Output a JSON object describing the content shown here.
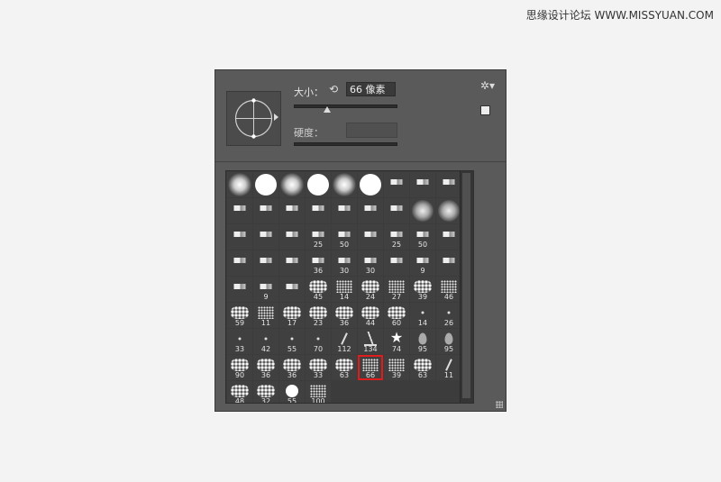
{
  "watermark": "思缘设计论坛 WWW.MISSYUAN.COM",
  "panel": {
    "size_label": "大小：",
    "size_value": "66 像素",
    "hardness_label": "硬度：",
    "reset_icon": "reset-icon",
    "gear_icon": "gear-icon",
    "new_preset_icon": "new-preset-icon"
  },
  "brushes": [
    {
      "shape": "soft",
      "num": ""
    },
    {
      "shape": "hard",
      "num": ""
    },
    {
      "shape": "soft",
      "num": ""
    },
    {
      "shape": "hard",
      "num": ""
    },
    {
      "shape": "soft",
      "num": ""
    },
    {
      "shape": "hard",
      "num": ""
    },
    {
      "shape": "tip",
      "num": ""
    },
    {
      "shape": "tip",
      "num": ""
    },
    {
      "shape": "tip",
      "num": ""
    },
    {
      "shape": "tip",
      "num": ""
    },
    {
      "shape": "tip",
      "num": ""
    },
    {
      "shape": "tip",
      "num": ""
    },
    {
      "shape": "tip",
      "num": ""
    },
    {
      "shape": "tip",
      "num": ""
    },
    {
      "shape": "tip",
      "num": ""
    },
    {
      "shape": "tip",
      "num": ""
    },
    {
      "shape": "blur",
      "num": ""
    },
    {
      "shape": "blur",
      "num": ""
    },
    {
      "shape": "tip",
      "num": ""
    },
    {
      "shape": "tip",
      "num": ""
    },
    {
      "shape": "tip",
      "num": ""
    },
    {
      "shape": "tip",
      "num": "25"
    },
    {
      "shape": "tip",
      "num": "50"
    },
    {
      "shape": "tip",
      "num": ""
    },
    {
      "shape": "tip",
      "num": "25"
    },
    {
      "shape": "tip",
      "num": "50"
    },
    {
      "shape": "tip",
      "num": ""
    },
    {
      "shape": "tip",
      "num": ""
    },
    {
      "shape": "tip",
      "num": ""
    },
    {
      "shape": "tip",
      "num": ""
    },
    {
      "shape": "tip",
      "num": "36"
    },
    {
      "shape": "tip",
      "num": "30"
    },
    {
      "shape": "tip",
      "num": "30"
    },
    {
      "shape": "tip",
      "num": ""
    },
    {
      "shape": "tip",
      "num": "9"
    },
    {
      "shape": "tip",
      "num": ""
    },
    {
      "shape": "tip",
      "num": ""
    },
    {
      "shape": "tip",
      "num": "9"
    },
    {
      "shape": "tip",
      "num": ""
    },
    {
      "shape": "tex",
      "num": "45"
    },
    {
      "shape": "dots",
      "num": "14"
    },
    {
      "shape": "tex",
      "num": "24"
    },
    {
      "shape": "dots",
      "num": "27"
    },
    {
      "shape": "tex",
      "num": "39"
    },
    {
      "shape": "dots",
      "num": "46"
    },
    {
      "shape": "tex",
      "num": "59"
    },
    {
      "shape": "dots",
      "num": "11"
    },
    {
      "shape": "tex",
      "num": "17"
    },
    {
      "shape": "tex",
      "num": "23"
    },
    {
      "shape": "tex",
      "num": "36"
    },
    {
      "shape": "tex",
      "num": "44"
    },
    {
      "shape": "tex",
      "num": "60"
    },
    {
      "shape": "dot",
      "num": "14"
    },
    {
      "shape": "dot",
      "num": "26"
    },
    {
      "shape": "dot",
      "num": "33"
    },
    {
      "shape": "dot",
      "num": "42"
    },
    {
      "shape": "dot",
      "num": "55"
    },
    {
      "shape": "dot",
      "num": "70"
    },
    {
      "shape": "stroke",
      "num": "112"
    },
    {
      "shape": "grass",
      "num": "134"
    },
    {
      "shape": "star",
      "num": "74"
    },
    {
      "shape": "leaf",
      "num": "95"
    },
    {
      "shape": "leaf",
      "num": "95"
    },
    {
      "shape": "tex",
      "num": "90"
    },
    {
      "shape": "tex",
      "num": "36"
    },
    {
      "shape": "tex",
      "num": "36"
    },
    {
      "shape": "tex",
      "num": "33"
    },
    {
      "shape": "tex",
      "num": "63"
    },
    {
      "shape": "dots",
      "num": "66"
    },
    {
      "shape": "dots",
      "num": "39"
    },
    {
      "shape": "tex",
      "num": "63"
    },
    {
      "shape": "stroke",
      "num": "11"
    },
    {
      "shape": "tex",
      "num": "48"
    },
    {
      "shape": "tex",
      "num": "32"
    },
    {
      "shape": "small",
      "num": "55"
    },
    {
      "shape": "dots",
      "num": "100"
    }
  ],
  "selected_index": 68
}
